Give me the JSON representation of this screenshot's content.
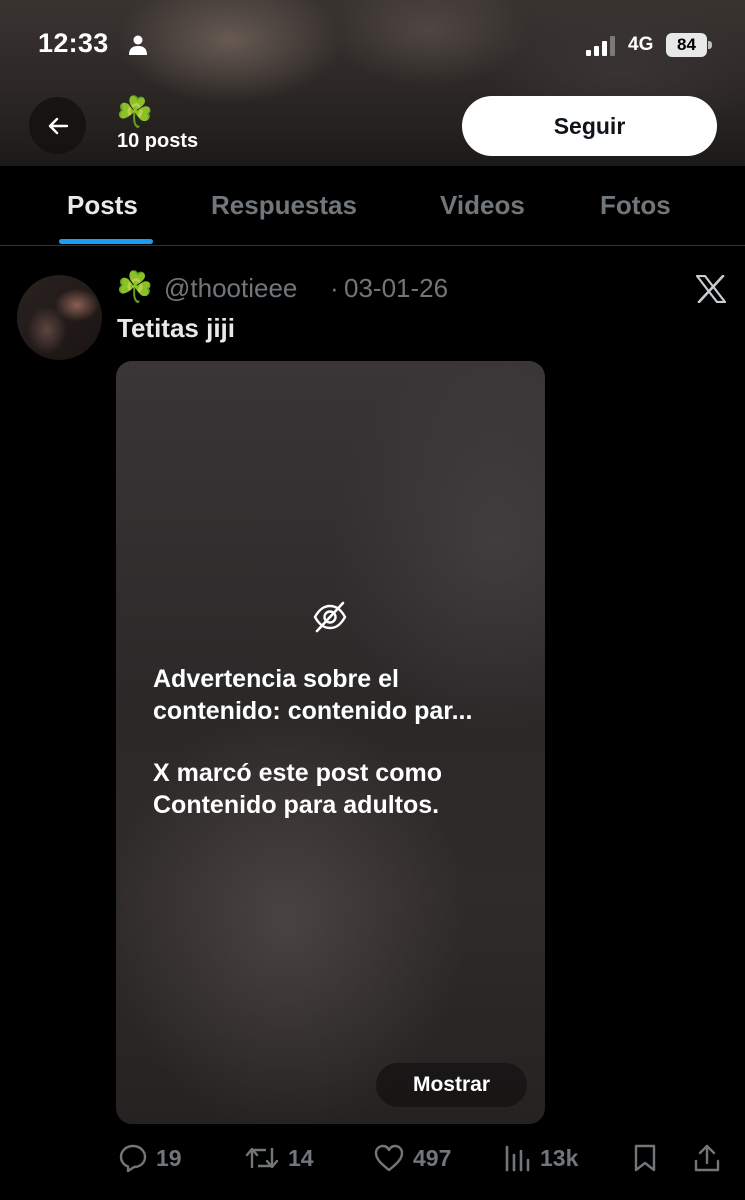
{
  "status_bar": {
    "time": "12:33",
    "network": "4G",
    "battery": "84"
  },
  "header": {
    "profile_emoji": "☘️",
    "post_count": "10 posts",
    "follow_label": "Seguir"
  },
  "tabs": [
    {
      "label": "Posts",
      "active": true
    },
    {
      "label": "Respuestas",
      "active": false
    },
    {
      "label": "Videos",
      "active": false
    },
    {
      "label": "Fotos",
      "active": false
    }
  ],
  "post": {
    "emoji": "☘️",
    "handle": "@thootieee",
    "separator": "·",
    "date": "03-01-26",
    "text": "Tetitas jiji",
    "media_warning": {
      "title": "Advertencia sobre el contenido: contenido par...",
      "body": "X marcó este post como Contenido para adultos.",
      "show_label": "Mostrar"
    },
    "actions": {
      "replies": "19",
      "reposts": "14",
      "likes": "497",
      "views": "13k"
    }
  },
  "colors": {
    "accent": "#1d9bf0",
    "muted_text": "#71767b",
    "primary_text": "#e7e9ea",
    "background": "#000000"
  },
  "icons": [
    "person-icon",
    "signal-icon",
    "back-arrow-icon",
    "x-logo-icon",
    "eye-slash-icon",
    "reply-icon",
    "repost-icon",
    "like-icon",
    "views-icon",
    "bookmark-icon",
    "share-icon"
  ]
}
